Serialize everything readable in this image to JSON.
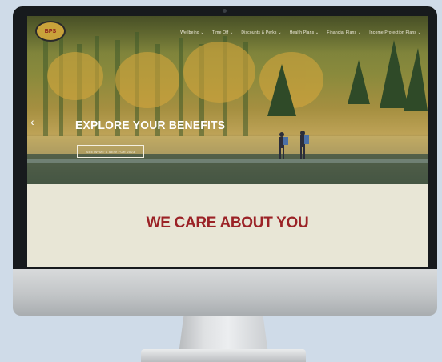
{
  "brand": {
    "logo_text": "Bass Pro Shops"
  },
  "nav": {
    "items": [
      {
        "label": "Wellbeing ⌄"
      },
      {
        "label": "Time Off ⌄"
      },
      {
        "label": "Discounts & Perks ⌄"
      },
      {
        "label": "Health Plans ⌄"
      },
      {
        "label": "Financial Plans ⌄"
      },
      {
        "label": "Income Protection Plans ⌄"
      }
    ]
  },
  "hero": {
    "title": "EXPLORE YOUR BENEFITS",
    "cta_label": "SEE WHAT'S NEW FOR 2023",
    "prev_arrow": "‹"
  },
  "section": {
    "title": "WE CARE ABOUT YOU"
  },
  "colors": {
    "accent_red": "#9b2226",
    "section_bg": "#e8e6d6",
    "page_bg": "#cfdbe8"
  }
}
